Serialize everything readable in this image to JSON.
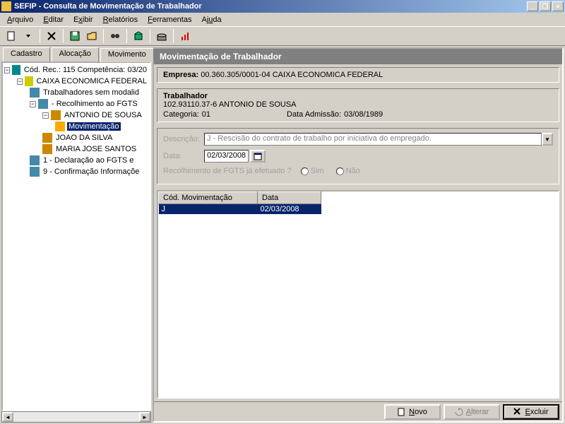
{
  "window": {
    "title": "SEFIP - Consulta de Movimentação de Trabalhador"
  },
  "menu": {
    "arquivo": "Arquivo",
    "editar": "Editar",
    "exibir": "Exibir",
    "relatorios": "Relatórios",
    "ferramentas": "Ferramentas",
    "ajuda": "Ajuda"
  },
  "tabs": {
    "cadastro": "Cadastro",
    "alocacao": "Alocação",
    "movimento": "Movimento"
  },
  "tree": {
    "root": "Cód. Rec.: 115 Competência: 03/20",
    "empresa": "CAIXA ECONOMICA FEDERAL",
    "semmod": "Trabalhadores sem modalid",
    "recolfgts": " - Recolhimento ao FGTS",
    "worker1": "ANTONIO DE SOUSA",
    "moviment": "Movimentação",
    "worker2": "JOAO DA SILVA",
    "worker3": "MARIA JOSE SANTOS",
    "decl": "1 - Declaração ao FGTS e ",
    "conf": "9 - Confirmação Informaçõe"
  },
  "panel": {
    "heading": "Movimentação de Trabalhador",
    "empresa_label": "Empresa:",
    "empresa_value": "00.360.305/0001-04  CAIXA ECONOMICA FEDERAL",
    "trabalhador_label": "Trabalhador",
    "trabalhador_pis": "102.93110.37-6 ANTONIO DE SOUSA",
    "categoria_label": "Categoria:",
    "categoria_value": "01",
    "admissao_label": "Data Admissão:",
    "admissao_value": "03/08/1989"
  },
  "form": {
    "descricao_label": "Descrição:",
    "descricao_value": "J  - Rescisão do contrato de trabalho por iniciativa do empregado.",
    "data_label": "Data:",
    "data_value": "02/03/2008",
    "recolhimento_label": "Recolhimento de FGTS já efetuado ?",
    "sim": "Sim",
    "nao": "Não"
  },
  "grid": {
    "col1": "Cód. Movimentação",
    "col2": "Data",
    "row1_cod": "J",
    "row1_data": "02/03/2008"
  },
  "buttons": {
    "novo": "Novo",
    "alterar": "Alterar",
    "excluir": "Excluir"
  }
}
